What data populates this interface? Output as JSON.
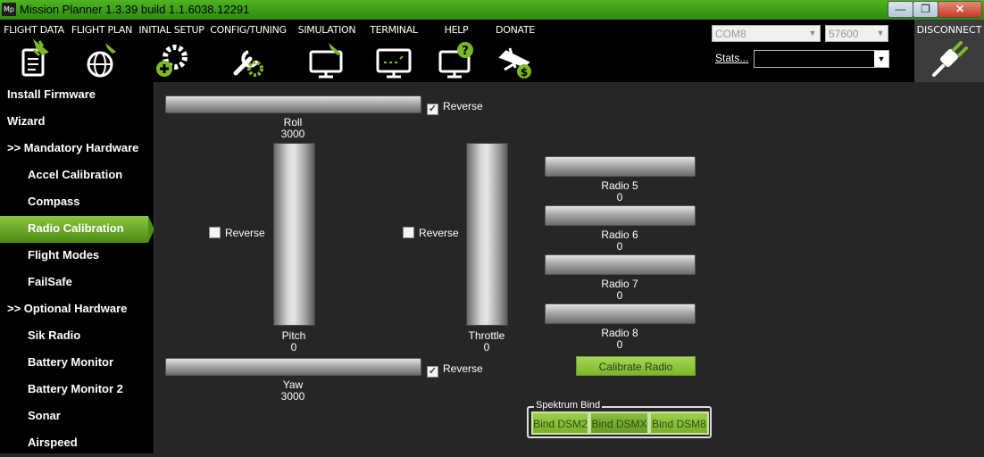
{
  "window": {
    "app_icon_text": "Mp",
    "title": "Mission Planner 1.3.39 build 1.1.6038.12291",
    "minimize": "—",
    "maximize": "❐",
    "close": "✕"
  },
  "toolbar": {
    "items": [
      {
        "label": "FLIGHT DATA",
        "icon": "flight-data-icon"
      },
      {
        "label": "FLIGHT PLAN",
        "icon": "flight-plan-icon"
      },
      {
        "label": "INITIAL SETUP",
        "icon": "initial-setup-icon"
      },
      {
        "label": "CONFIG/TUNING",
        "icon": "config-tuning-icon"
      },
      {
        "label": "SIMULATION",
        "icon": "simulation-icon"
      },
      {
        "label": "TERMINAL",
        "icon": "terminal-icon"
      },
      {
        "label": "HELP",
        "icon": "help-icon"
      },
      {
        "label": "DONATE",
        "icon": "donate-icon"
      }
    ],
    "port": "COM8",
    "baud": "57600",
    "stats_link": "Stats...",
    "disconnect_label": "DISCONNECT"
  },
  "sidebar": {
    "items": [
      {
        "label": "Install Firmware"
      },
      {
        "label": "Wizard"
      },
      {
        "label": ">> Mandatory Hardware"
      },
      {
        "label": "Accel Calibration"
      },
      {
        "label": "Compass"
      },
      {
        "label": "Radio Calibration",
        "active": true
      },
      {
        "label": "Flight Modes"
      },
      {
        "label": "FailSafe"
      },
      {
        "label": ">> Optional Hardware"
      },
      {
        "label": "Sik Radio"
      },
      {
        "label": "Battery Monitor"
      },
      {
        "label": "Battery Monitor 2"
      },
      {
        "label": "Sonar"
      },
      {
        "label": "Airspeed"
      }
    ]
  },
  "radio": {
    "roll": {
      "name": "Roll",
      "value": "3000",
      "reverse_label": "Reverse",
      "reversed": true
    },
    "pitch": {
      "name": "Pitch",
      "value": "0",
      "reverse_label": "Reverse",
      "reversed": false
    },
    "throttle": {
      "name": "Throttle",
      "value": "0",
      "reverse_label": "Reverse",
      "reversed": false
    },
    "yaw": {
      "name": "Yaw",
      "value": "3000",
      "reverse_label": "Reverse",
      "reversed": true
    },
    "radio5": {
      "name": "Radio 5",
      "value": "0"
    },
    "radio6": {
      "name": "Radio 6",
      "value": "0"
    },
    "radio7": {
      "name": "Radio 7",
      "value": "0"
    },
    "radio8": {
      "name": "Radio 8",
      "value": "0"
    },
    "calibrate_label": "Calibrate Radio",
    "spektrum": {
      "title": "Spektrum Bind",
      "dsm2": "Bind DSM2",
      "dsmx": "Bind DSMX",
      "dsm8": "Bind DSM8"
    }
  },
  "colors": {
    "accent_green": "#7cb828",
    "titlebar_green": "#3c9e18",
    "background": "#262626"
  }
}
